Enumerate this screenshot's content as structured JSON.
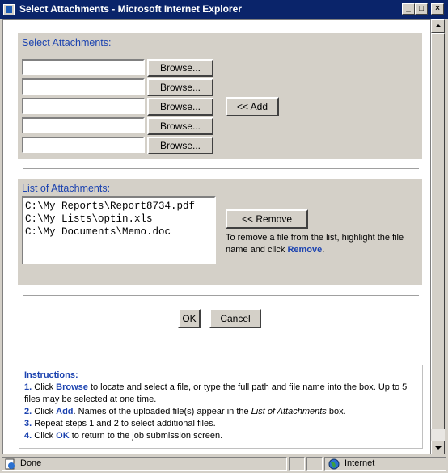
{
  "window": {
    "title": "Select Attachments - Microsoft Internet Explorer",
    "minimize": "_",
    "maximize": "□",
    "close": "×"
  },
  "select_section": {
    "label": "Select Attachments:",
    "browse_label": "Browse...",
    "add_label": "<< Add"
  },
  "list_section": {
    "label": "List of Attachments:",
    "files": [
      "C:\\My Reports\\Report8734.pdf",
      "C:\\My Lists\\optin.xls",
      "C:\\My Documents\\Memo.doc"
    ],
    "remove_label": "<< Remove",
    "remove_help_prefix": "To remove a file from the list, highlight the file name and click ",
    "remove_help_link": "Remove",
    "remove_help_suffix": "."
  },
  "actions": {
    "ok_label": "OK",
    "cancel_label": "Cancel"
  },
  "instructions": {
    "header": "Instructions:",
    "step1": {
      "num": "1.",
      "pre": " Click ",
      "key": "Browse",
      "post": " to locate and select a file, or type the full path and file name into the box. Up to 5 files may be selected at one time."
    },
    "step2": {
      "num": "2.",
      "pre": " Click ",
      "key": "Add",
      "mid": ". Names of the uploaded file(s) appear in the ",
      "italic": "List of Attachments",
      "post": " box."
    },
    "step3": {
      "num": "3.",
      "text": " Repeat steps 1 and 2 to select additional files."
    },
    "step4": {
      "num": "4.",
      "pre": " Click ",
      "key": "OK",
      "post": " to return to the job submission screen."
    }
  },
  "statusbar": {
    "status": "Done",
    "zone": "Internet"
  },
  "colors": {
    "titlebar": "#0a246a",
    "accent": "#1c43b0",
    "panel": "#d4d0c8"
  },
  "icons": [
    "ie-page-icon",
    "minimize-icon",
    "maximize-icon",
    "close-icon",
    "scroll-up-icon",
    "scroll-down-icon",
    "globe-icon"
  ]
}
